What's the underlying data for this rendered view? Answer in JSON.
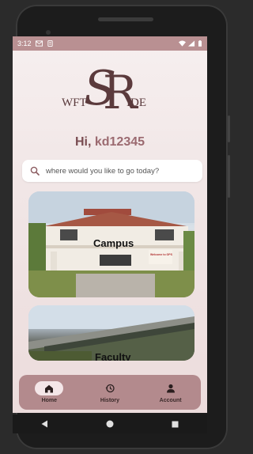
{
  "status_bar": {
    "time": "3:12",
    "left_icons": [
      "gmail-icon",
      "storage-icon"
    ],
    "right_icons": [
      "wifi-icon",
      "signal-icon",
      "battery-icon"
    ]
  },
  "logo": {
    "left_text": "WFT",
    "monogram": "SR",
    "right_text": "IDE"
  },
  "greeting": {
    "prefix": "Hi,",
    "username": "kd12345"
  },
  "search": {
    "placeholder": "where would you like to go today?",
    "value": ""
  },
  "cards": [
    {
      "label": "Campus",
      "image": "campus-building-photo",
      "sign_text": "Welcome to GPS"
    },
    {
      "label": "Faculty",
      "image": "faculty-building-photo"
    }
  ],
  "bottom_nav": {
    "items": [
      {
        "label": "Home",
        "icon": "home-icon",
        "active": true
      },
      {
        "label": "History",
        "icon": "history-icon",
        "active": false
      },
      {
        "label": "Account",
        "icon": "account-icon",
        "active": false
      }
    ]
  },
  "system_nav": [
    "back-icon",
    "home-circle-icon",
    "recents-icon"
  ],
  "colors": {
    "accent": "#b38a8d",
    "status_bar": "#b99092",
    "greeting_text": "#8a5a5f",
    "logo": "#5b3a3c",
    "active_pill": "#f4e6e8"
  }
}
